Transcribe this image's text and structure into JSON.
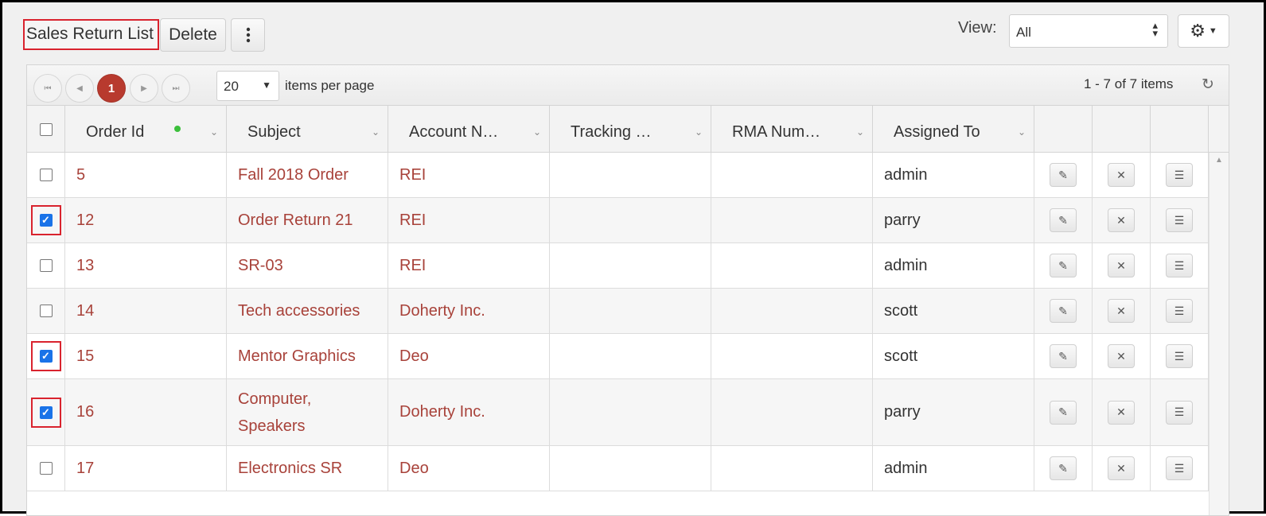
{
  "toolbar": {
    "title": "Sales Return List",
    "delete_label": "Delete",
    "view_label": "View:",
    "view_value": "All"
  },
  "pager": {
    "current_page": "1",
    "per_page": "20",
    "per_page_label": "items per page",
    "range": "1 - 7 of 7 items"
  },
  "columns": [
    "Order Id",
    "Subject",
    "Account N…",
    "Tracking …",
    "RMA Num…",
    "Assigned To"
  ],
  "rows": [
    {
      "id": "5",
      "subject": [
        "Fall 2018 Order"
      ],
      "account": "REI",
      "tracking": "",
      "rma": "",
      "assigned": "admin",
      "checked": false
    },
    {
      "id": "12",
      "subject": [
        "Order Return 21"
      ],
      "account": "REI",
      "tracking": "",
      "rma": "",
      "assigned": "parry",
      "checked": true
    },
    {
      "id": "13",
      "subject": [
        "SR-03"
      ],
      "account": "REI",
      "tracking": "",
      "rma": "",
      "assigned": "admin",
      "checked": false
    },
    {
      "id": "14",
      "subject": [
        "Tech accessories"
      ],
      "account": "Doherty Inc.",
      "tracking": "",
      "rma": "",
      "assigned": "scott",
      "checked": false
    },
    {
      "id": "15",
      "subject": [
        "Mentor Graphics"
      ],
      "account": "Deo",
      "tracking": "",
      "rma": "",
      "assigned": "scott",
      "checked": true
    },
    {
      "id": "16",
      "subject": [
        "Computer,",
        "Speakers"
      ],
      "account": "Doherty Inc.",
      "tracking": "",
      "rma": "",
      "assigned": "parry",
      "checked": true
    },
    {
      "id": "17",
      "subject": [
        "Electronics SR"
      ],
      "account": "Deo",
      "tracking": "",
      "rma": "",
      "assigned": "admin",
      "checked": false
    }
  ],
  "icons": {
    "more": "more-vertical-icon",
    "gear": "gear-icon",
    "edit": "pencil-icon",
    "delete": "close-icon",
    "menu": "menu-icon",
    "refresh": "refresh-icon"
  },
  "colors": {
    "link": "#a8423a",
    "active_page": "#b83a2e",
    "checkbox_checked": "#1a73e8",
    "highlight": "#d9232e",
    "sorted_indicator": "#3bbf3b"
  }
}
